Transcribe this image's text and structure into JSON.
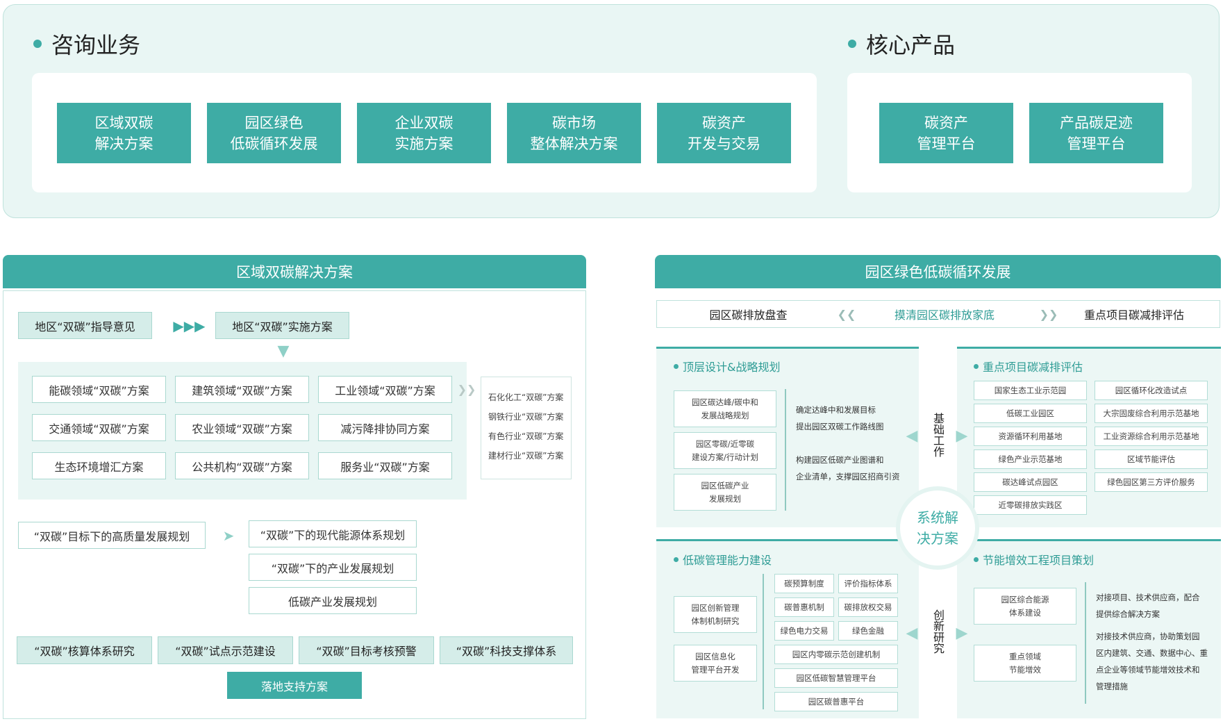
{
  "top": {
    "consulting": {
      "title": "咨询业务",
      "items": [
        "区域双碳\n解决方案",
        "园区绿色\n低碳循环发展",
        "企业双碳\n实施方案",
        "碳市场\n整体解决方案",
        "碳资产\n开发与交易"
      ]
    },
    "core": {
      "title": "核心产品",
      "items": [
        "碳资产\n管理平台",
        "产品碳足迹\n管理平台"
      ]
    }
  },
  "left": {
    "header": "区域双碳解决方案",
    "guide": "地区“双碳”指导意见",
    "implement": "地区“双碳”实施方案",
    "grid": [
      "能碳领域“双碳”方案",
      "建筑领域“双碳”方案",
      "工业领域“双碳”方案",
      "交通领域“双碳”方案",
      "农业领域“双碳”方案",
      "减污降排协同方案",
      "生态环境增汇方案",
      "公共机构“双碳”方案",
      "服务业“双碳”方案"
    ],
    "industries": [
      "石化化工“双碳”方案",
      "钢铁行业“双碳”方案",
      "有色行业“双碳”方案",
      "建材行业“双碳”方案"
    ],
    "plan_left": "“双碳”目标下的高质量发展规划",
    "plans": [
      "“双碳”下的现代能源体系规划",
      "“双碳”下的产业发展规划",
      "低碳产业发展规划"
    ],
    "support": [
      "“双碳”核算体系研究",
      "“双碳”试点示范建设",
      "“双碳”目标考核预警",
      "“双碳”科技支撑体系"
    ],
    "landing": "落地支持方案"
  },
  "right": {
    "header": "园区绿色低碳循环发展",
    "topbar": {
      "left": "园区碳排放盘查",
      "middle": "摸清园区碳排放家底",
      "right": "重点项目碳减排评估"
    },
    "q1": {
      "title": "顶层设计&战略规划",
      "boxes": [
        "园区碳达峰/碳中和\n发展战略规划",
        "园区零碳/近零碳\n建设方案/行动计划",
        "园区低碳产业\n发展规划"
      ],
      "texts": [
        "确定达峰中和发展目标\n提出园区双碳工作路线图",
        "构建园区低碳产业图谱和\n企业清单，支撑园区招商引资"
      ]
    },
    "q2": {
      "title": "重点项目碳减排评估",
      "col1": [
        "国家生态工业示范园",
        "低碳工业园区",
        "资源循环利用基地",
        "绿色产业示范基地",
        "碳达峰试点园区",
        "近零碳排放实践区"
      ],
      "col2": [
        "园区循环化改造试点",
        "大宗固废综合利用示范基地",
        "工业资源综合利用示范基地",
        "区域节能评估",
        "绿色园区第三方评价服务"
      ]
    },
    "q3": {
      "title": "低碳管理能力建设",
      "left": [
        "园区创新管理\n体制机制研究",
        "园区信息化\n管理平台开发"
      ],
      "pairs": [
        [
          "碳预算制度",
          "评价指标体系"
        ],
        [
          "碳普惠机制",
          "碳排放权交易"
        ],
        [
          "绿色电力交易",
          "绿色金融"
        ]
      ],
      "wide": [
        "园区内零碳示范创建机制",
        "园区低碳智慧管理平台",
        "园区碳普惠平台"
      ]
    },
    "q4": {
      "title": "节能增效工程项目策划",
      "boxes": [
        "园区综合能源\n体系建设",
        "重点领域\n节能增效"
      ],
      "texts": [
        "对接项目、技术供应商，配合\n提供综合解决方案",
        "对接技术供应商，协助策划园\n区内建筑、交通、数据中心、重\n点企业等领域节能增效技术和\n管理措施"
      ]
    },
    "center": "系统解\n决方案",
    "v_top": "基础工作",
    "v_bottom": "创新研究"
  },
  "colors": {
    "teal": "#3eaca5",
    "light_teal": "#d5ede9",
    "banner_bg": "#e9f6f4"
  }
}
